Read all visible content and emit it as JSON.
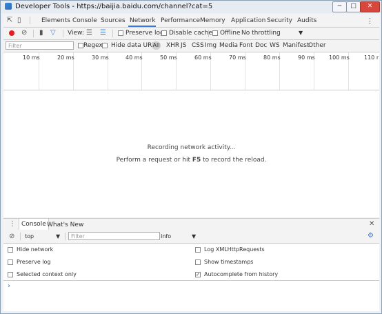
{
  "window": {
    "title": "Developer Tools - https://baijia.baidu.com/channel?cat=5",
    "min_label": "─",
    "max_label": "□",
    "close_label": "✕"
  },
  "tabs": [
    "Elements",
    "Console",
    "Sources",
    "Network",
    "Performance",
    "Memory",
    "Application",
    "Security",
    "Audits"
  ],
  "active_tab": "Network",
  "toolbar": {
    "view_label": "View:",
    "preserve_log": "Preserve log",
    "disable_cache": "Disable cache",
    "offline": "Offline",
    "throttling": "No throttling"
  },
  "filterbar": {
    "placeholder": "Filter",
    "regex": "Regex",
    "hide_data_urls": "Hide data URLs",
    "types": [
      "All",
      "XHR",
      "JS",
      "CSS",
      "Img",
      "Media",
      "Font",
      "Doc",
      "WS",
      "Manifest",
      "Other"
    ]
  },
  "timeline_ticks": [
    "10 ms",
    "20 ms",
    "30 ms",
    "40 ms",
    "50 ms",
    "60 ms",
    "70 ms",
    "80 ms",
    "90 ms",
    "100 ms",
    "110 r"
  ],
  "recording": {
    "line1": "Recording network activity...",
    "line2_before": "Perform a request or hit ",
    "line2_key": "F5",
    "line2_after": " to record the reload."
  },
  "drawer": {
    "tabs": [
      "Console",
      "What's New"
    ],
    "context": "top",
    "filter_placeholder": "Filter",
    "level": "Info"
  },
  "console_settings": {
    "hide_network": "Hide network",
    "preserve_log": "Preserve log",
    "selected_context_only": "Selected context only",
    "log_xhr": "Log XMLHttpRequests",
    "show_timestamps": "Show timestamps",
    "autocomplete": "Autocomplete from history",
    "autocomplete_checked": true
  },
  "colors": {
    "accent": "#3879d9",
    "record": "#e51c23",
    "close_button": "#d8473b"
  }
}
